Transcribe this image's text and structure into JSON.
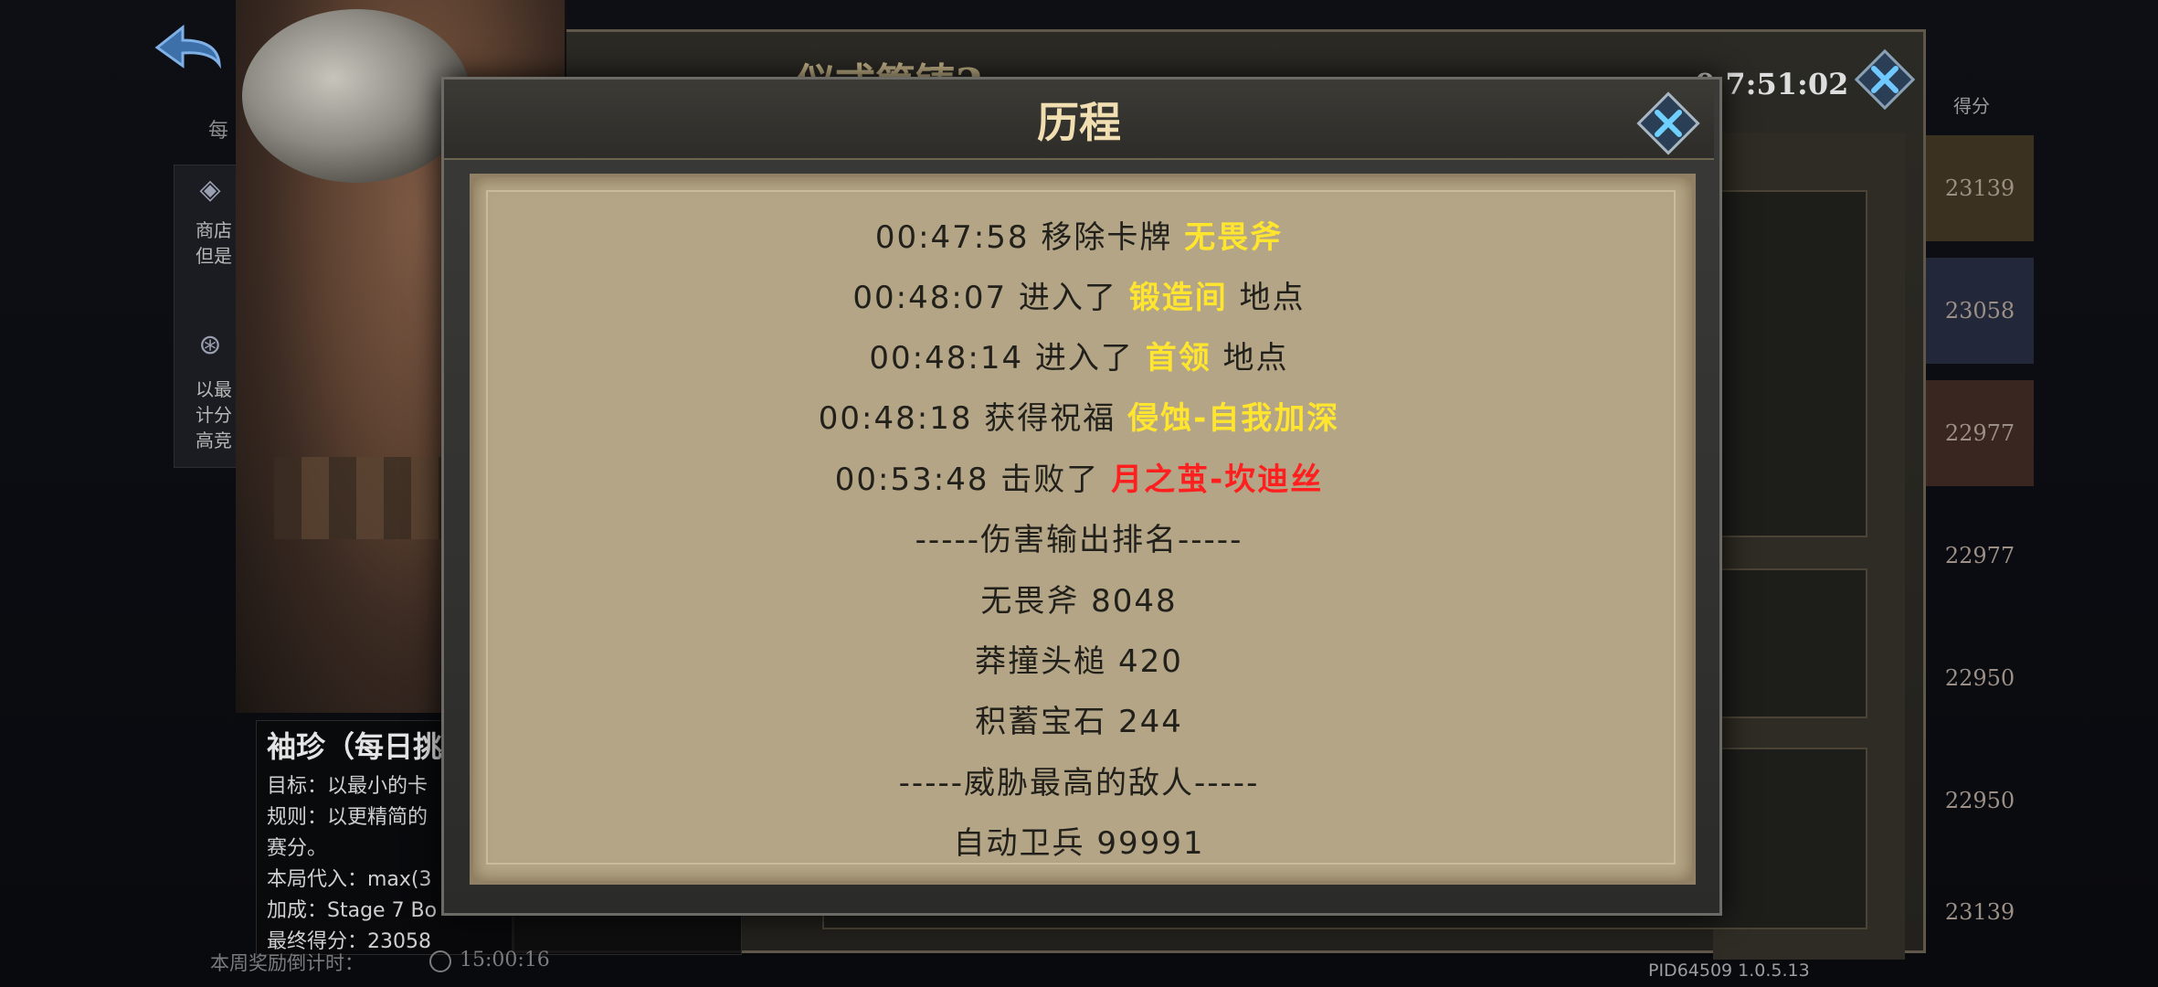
{
  "background": {
    "back_label": "每",
    "left_panel": {
      "item1": [
        "商店",
        "但是"
      ],
      "item2": [
        "以最",
        "计分",
        "高竞"
      ]
    },
    "window_title": "仪式筹铸2",
    "timer": "0 7:51:02",
    "score_header": "得分",
    "scores": [
      "23139",
      "23058",
      "22977",
      "22977",
      "22950",
      "22950",
      "23139"
    ],
    "footer_pid": "PID64509  1.0.5.13"
  },
  "character_info": {
    "name": "袖珍（每日挑",
    "goal": "目标：以最小的卡",
    "rule": "规则：以更精简的",
    "rule_cont": "赛分。",
    "round_input": "本局代入：max(3",
    "bonus": "加成：Stage 7 Bo",
    "final_score": "最终得分：23058",
    "countdown_label": "本周奖励倒计时：",
    "countdown_value": "15:00:16"
  },
  "modal": {
    "title": "历程",
    "lines": [
      {
        "prefix": "00:47:58 移除卡牌 ",
        "hl": "无畏斧",
        "suffix": ""
      },
      {
        "prefix": "00:48:07 进入了 ",
        "hl": "锻造间",
        "suffix": " 地点"
      },
      {
        "prefix": "00:48:14 进入了 ",
        "hl": "首领",
        "suffix": " 地点"
      },
      {
        "prefix": "00:48:18 获得祝福 ",
        "hl": "侵蚀-自我加深",
        "suffix": ""
      },
      {
        "prefix": "00:53:48 击败了 ",
        "hl": "月之茧-坎迪丝",
        "suffix": ""
      }
    ],
    "damage_header": "-----伤害输出排名-----",
    "damage": [
      "无畏斧  8048",
      "莽撞头槌  420",
      "积蓄宝石  244"
    ],
    "threat_header": "-----威胁最高的敌人-----",
    "threat": [
      "自动卫兵  99991"
    ]
  },
  "colors": {
    "highlight_yellow": "#ffe52e",
    "highlight_red": "#ff1f1f",
    "parchment": "#b3a586"
  }
}
